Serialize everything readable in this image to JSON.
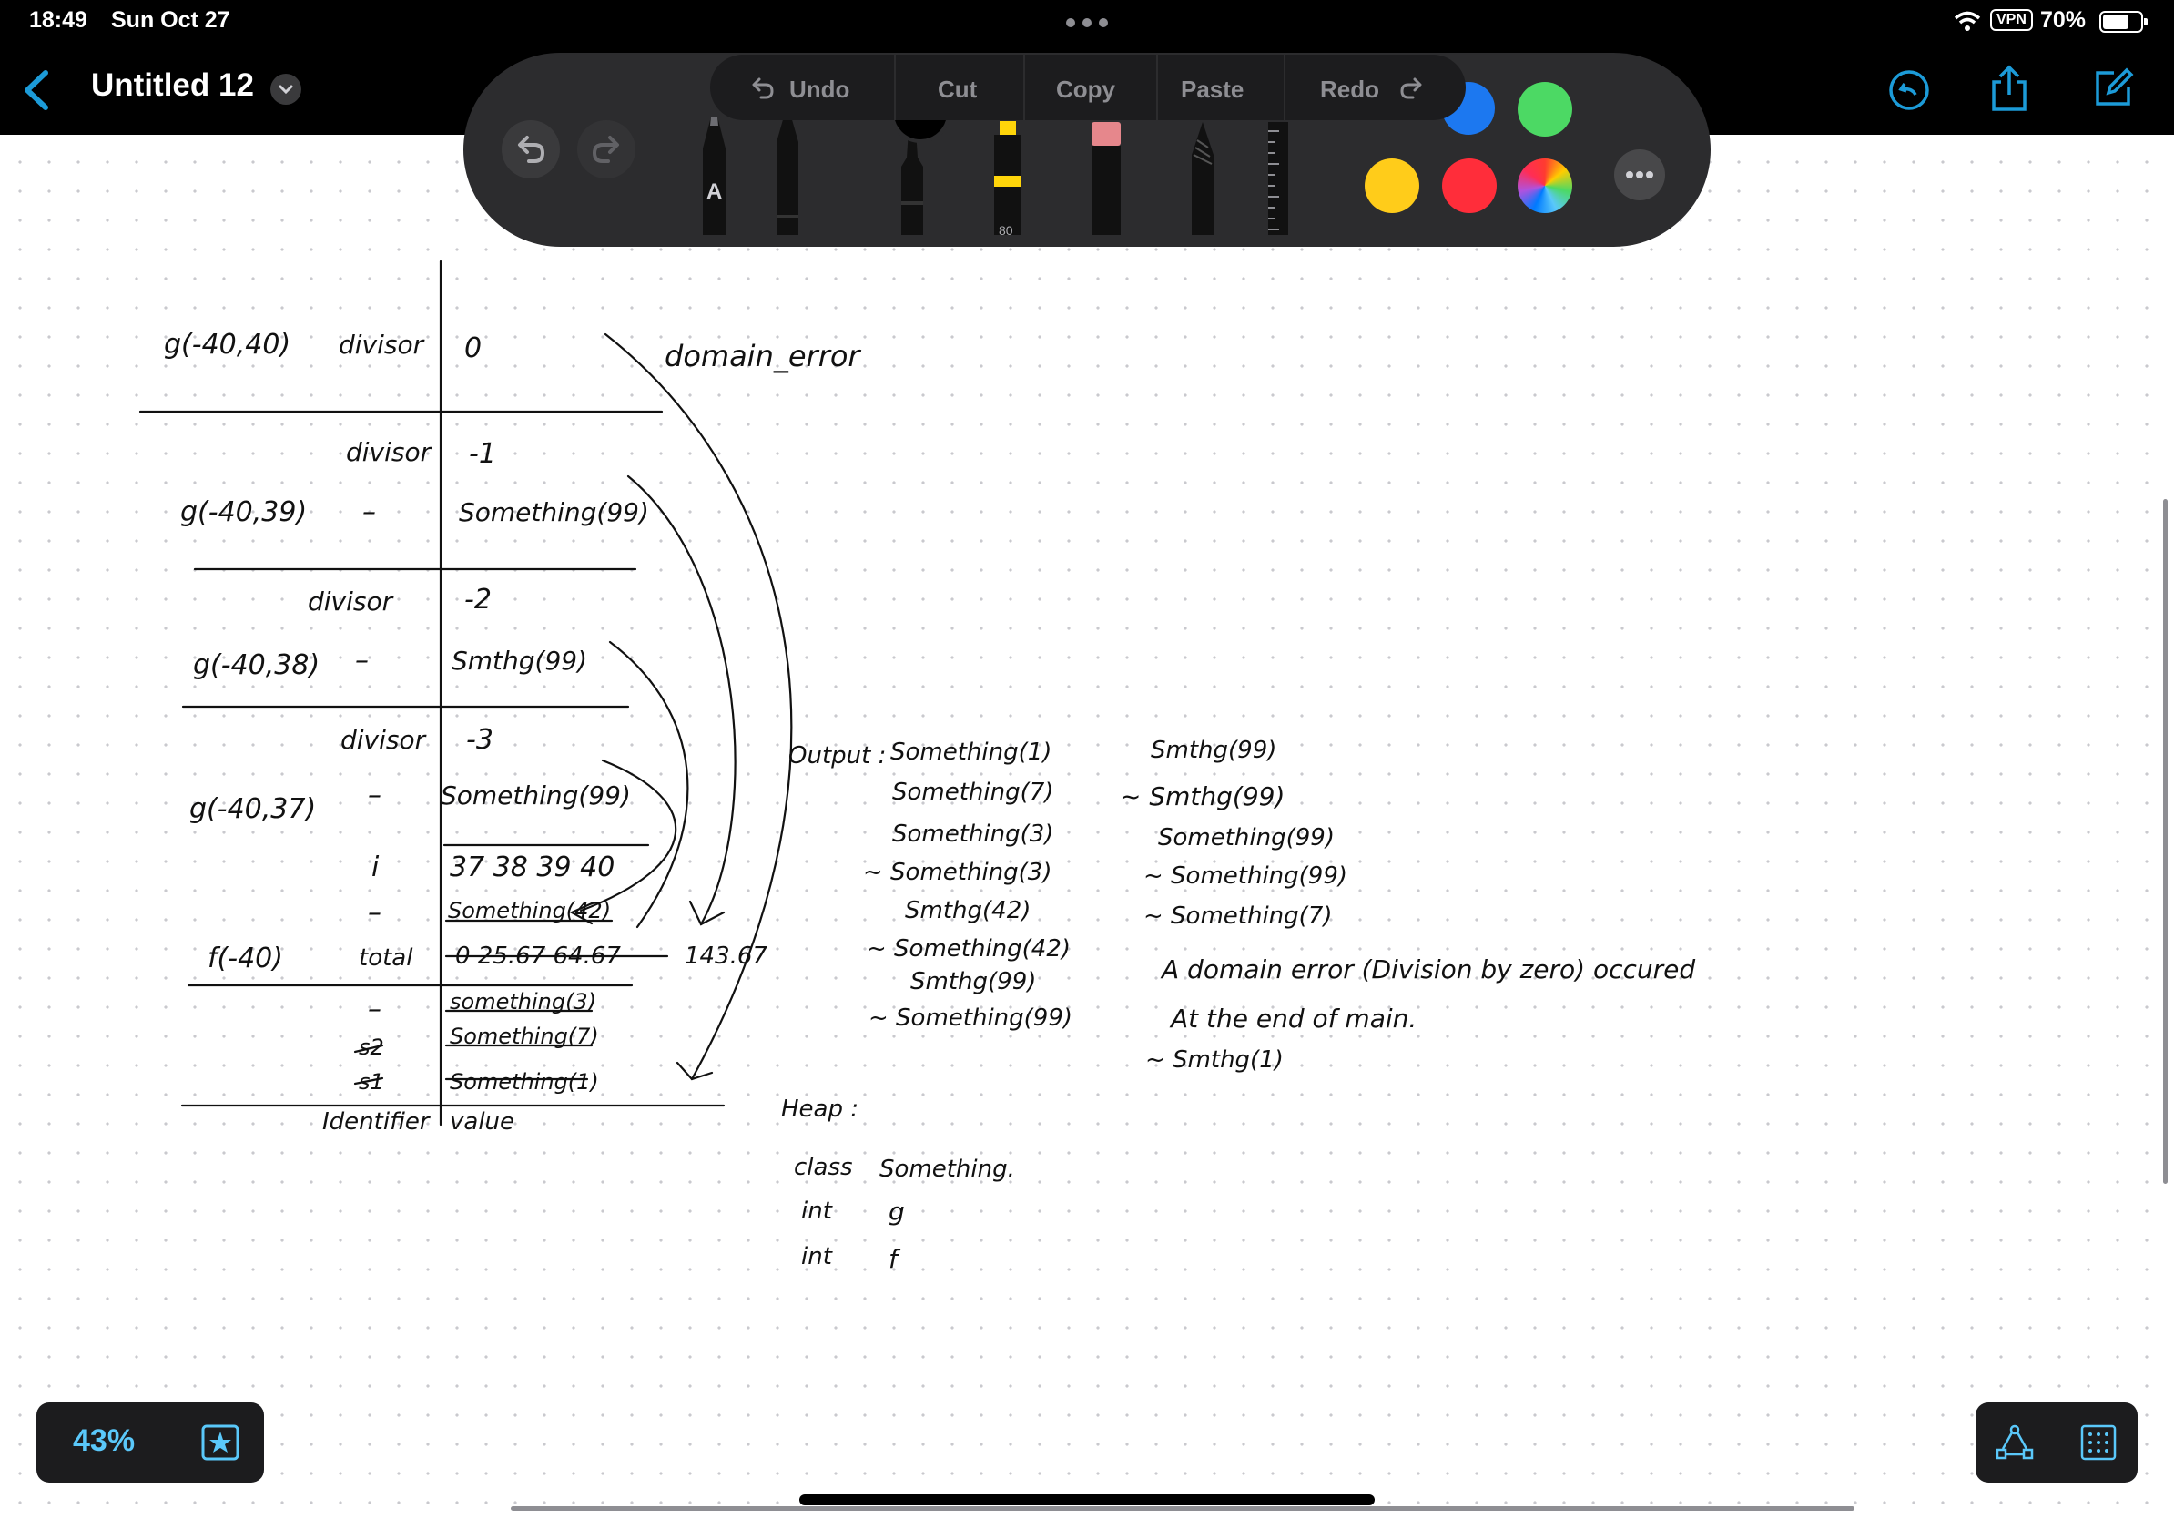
{
  "status": {
    "time": "18:49",
    "date": "Sun Oct 27",
    "vpn": "VPN",
    "battery": "70%"
  },
  "document": {
    "title": "Untitled 12"
  },
  "edit_menu": {
    "undo": "Undo",
    "cut": "Cut",
    "copy": "Copy",
    "paste": "Paste",
    "redo": "Redo"
  },
  "tools": {
    "pen_label": "A",
    "highlighter_size": "80"
  },
  "colors": {
    "blue": "#1c78f0",
    "green": "#4cd964",
    "yellow": "#ffcc1a",
    "red": "#ff2d3a",
    "accent": "#1c9bd8"
  },
  "zoom": {
    "level": "43%"
  },
  "notes": {
    "table_rows": [
      {
        "id": "g(-40,40)",
        "var": "divisor",
        "val": "0"
      },
      {
        "id": "",
        "var": "divisor",
        "val": "-1"
      },
      {
        "id": "g(-40,39)",
        "var": "–",
        "val": "Something(99)"
      },
      {
        "id": "",
        "var": "divisor",
        "val": "-2"
      },
      {
        "id": "g(-40,38)",
        "var": "–",
        "val": "Smthg(99)"
      },
      {
        "id": "",
        "var": "divisor",
        "val": "-3"
      },
      {
        "id": "g(-40,37)",
        "var": "–",
        "val": "Something(99)"
      },
      {
        "id": "",
        "var": "i",
        "val": "37  38  39  40"
      },
      {
        "id": "",
        "var": "–",
        "val": "Something(42)"
      },
      {
        "id": "f(-40)",
        "var": "total",
        "val": "0   25.67   64.67"
      },
      {
        "id": "",
        "var": "–",
        "val": "something(3)"
      },
      {
        "id": "",
        "var": "s2",
        "val": "Something(7)"
      },
      {
        "id": "",
        "var": "s1",
        "val": "Something(1)"
      }
    ],
    "total_final": "143.67",
    "col_identifier": "Identifier",
    "col_value": "value",
    "exception": "domain_error",
    "output_label": "Output :",
    "output_col1": [
      "Something(1)",
      "Something(7)",
      "Something(3)",
      "~ Something(3)",
      "Smthg(42)",
      "~ Something(42)",
      "Smthg(99)",
      "~ Something(99)"
    ],
    "output_col2": [
      "Smthg(99)",
      "~ Smthg(99)",
      "Something(99)",
      "~ Something(99)",
      "~ Something(7)"
    ],
    "domain_msg": "A domain error (Division by zero) occured",
    "end_msg": "At the end of main.",
    "last_dtor": "~ Smthg(1)",
    "heap_label": "Heap :",
    "heap_rows": [
      {
        "type": "class",
        "name": "Something."
      },
      {
        "type": "int",
        "name": "g"
      },
      {
        "type": "int",
        "name": "f"
      }
    ]
  }
}
